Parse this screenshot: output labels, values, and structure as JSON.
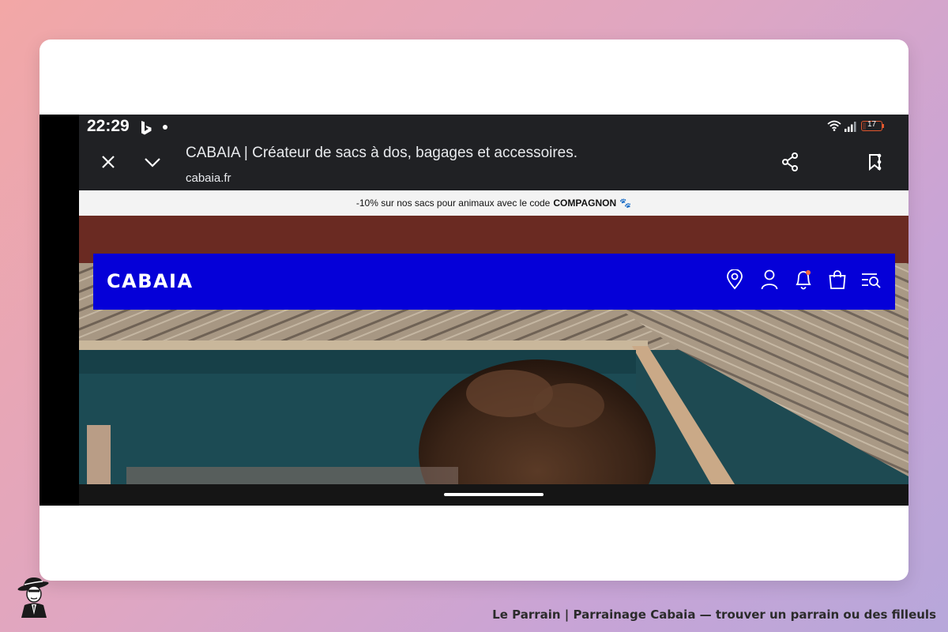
{
  "status_bar": {
    "time": "22:29",
    "notification_icons": [
      "bing-icon",
      "dot-icon"
    ],
    "system_icons": [
      "wifi-icon",
      "signal-icon",
      "battery-icon"
    ],
    "battery_level": "17",
    "battery_color": "#e2572e"
  },
  "browser_toolbar": {
    "page_title": "CABAIA | Créateur de sacs à dos, bagages et accessoires.",
    "url": "cabaia.fr",
    "buttons": [
      "close-icon",
      "chevron-down-icon",
      "share-icon",
      "bookmark-icon",
      "more-vert-icon"
    ]
  },
  "website": {
    "promo_prefix": "-10% sur nos sacs pour animaux avec le code",
    "promo_code": "COMPAGNON",
    "promo_emoji": "🐾",
    "logo": "CABAIA",
    "header_color": "#0500d8",
    "header_icons": [
      "location-pin-icon",
      "user-icon",
      "bell-icon",
      "shopping-bag-icon",
      "search-menu-icon"
    ],
    "notification_dot_color": "#ff6a3d"
  },
  "footer": {
    "caption": "Le Parrain | Parrainage Cabaia — trouver un parrain ou des filleuls",
    "logo_icon": "mafia-man-logo-icon"
  }
}
